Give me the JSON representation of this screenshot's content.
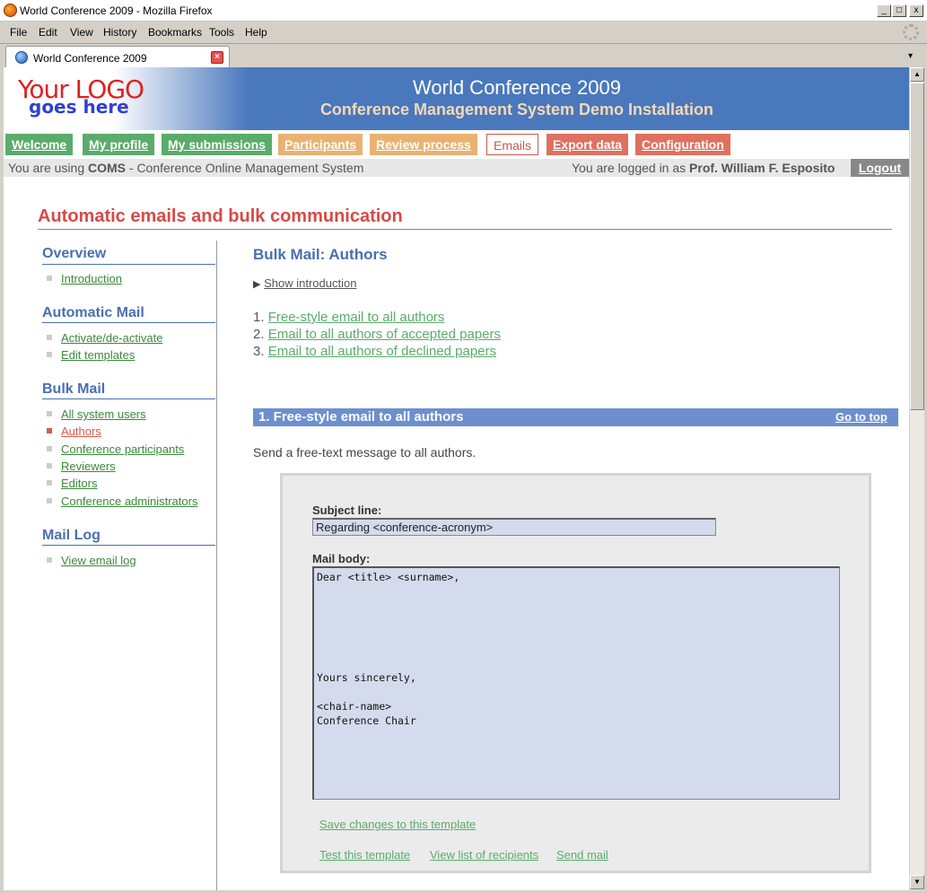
{
  "window": {
    "title": "World Conference 2009 - Mozilla Firefox",
    "controls": [
      "_",
      "□",
      "x"
    ]
  },
  "menu": [
    "File",
    "Edit",
    "View",
    "History",
    "Bookmarks",
    "Tools",
    "Help"
  ],
  "browser_tab": {
    "label": "World Conference 2009"
  },
  "logo": {
    "line1": "Your LOGO",
    "line2": "goes here"
  },
  "header": {
    "title": "World Conference 2009",
    "subtitle": "Conference Management System Demo Installation"
  },
  "nav": [
    {
      "label": "Welcome",
      "style": "green"
    },
    {
      "label": "My profile",
      "style": "green"
    },
    {
      "label": "My submissions",
      "style": "green"
    },
    {
      "label": "Participants",
      "style": "orange"
    },
    {
      "label": "Review process",
      "style": "orange"
    },
    {
      "label": "Emails",
      "style": "active"
    },
    {
      "label": "Export data",
      "style": "red"
    },
    {
      "label": "Configuration",
      "style": "red"
    }
  ],
  "status": {
    "prefix": "You are using ",
    "app": "COMS",
    "suffix": " - Conference Online Management System",
    "logged_prefix": "You are logged in as ",
    "user": "Prof. William F. Esposito",
    "logout": "Logout"
  },
  "page_title": "Automatic emails and bulk communication",
  "sidebar": [
    {
      "heading": "Overview",
      "items": [
        {
          "label": "Introduction",
          "active": false
        }
      ]
    },
    {
      "heading": "Automatic Mail",
      "items": [
        {
          "label": "Activate/de-activate",
          "active": false
        },
        {
          "label": "Edit templates",
          "active": false
        }
      ]
    },
    {
      "heading": "Bulk Mail",
      "items": [
        {
          "label": "All system users",
          "active": false
        },
        {
          "label": "Authors",
          "active": true
        },
        {
          "label": "Conference participants",
          "active": false
        },
        {
          "label": "Reviewers",
          "active": false
        },
        {
          "label": "Editors",
          "active": false
        },
        {
          "label": "Conference administrators",
          "active": false
        }
      ]
    },
    {
      "heading": "Mail Log",
      "items": [
        {
          "label": "View email log",
          "active": false
        }
      ]
    }
  ],
  "content": {
    "heading": "Bulk Mail: Authors",
    "show_intro": "Show introduction",
    "options": [
      {
        "num": "1.",
        "label": "Free-style email to all authors"
      },
      {
        "num": "2.",
        "label": "Email to all authors of accepted papers"
      },
      {
        "num": "3.",
        "label": "Email to all authors of declined papers"
      }
    ],
    "section": {
      "title": "1. Free-style email to all authors",
      "go_top": "Go to top",
      "description": "Send a free-text message to all authors."
    },
    "form": {
      "subject_label": "Subject line:",
      "subject_value": "Regarding <conference-acronym>",
      "body_label": "Mail body:",
      "body_value": "Dear <title> <surname>,\n\n\n\n\n\n\nYours sincerely,\n\n<chair-name>\nConference Chair",
      "save": "Save changes to this template",
      "test": "Test this template",
      "recipients": "View list of recipients",
      "send": "Send mail"
    }
  }
}
